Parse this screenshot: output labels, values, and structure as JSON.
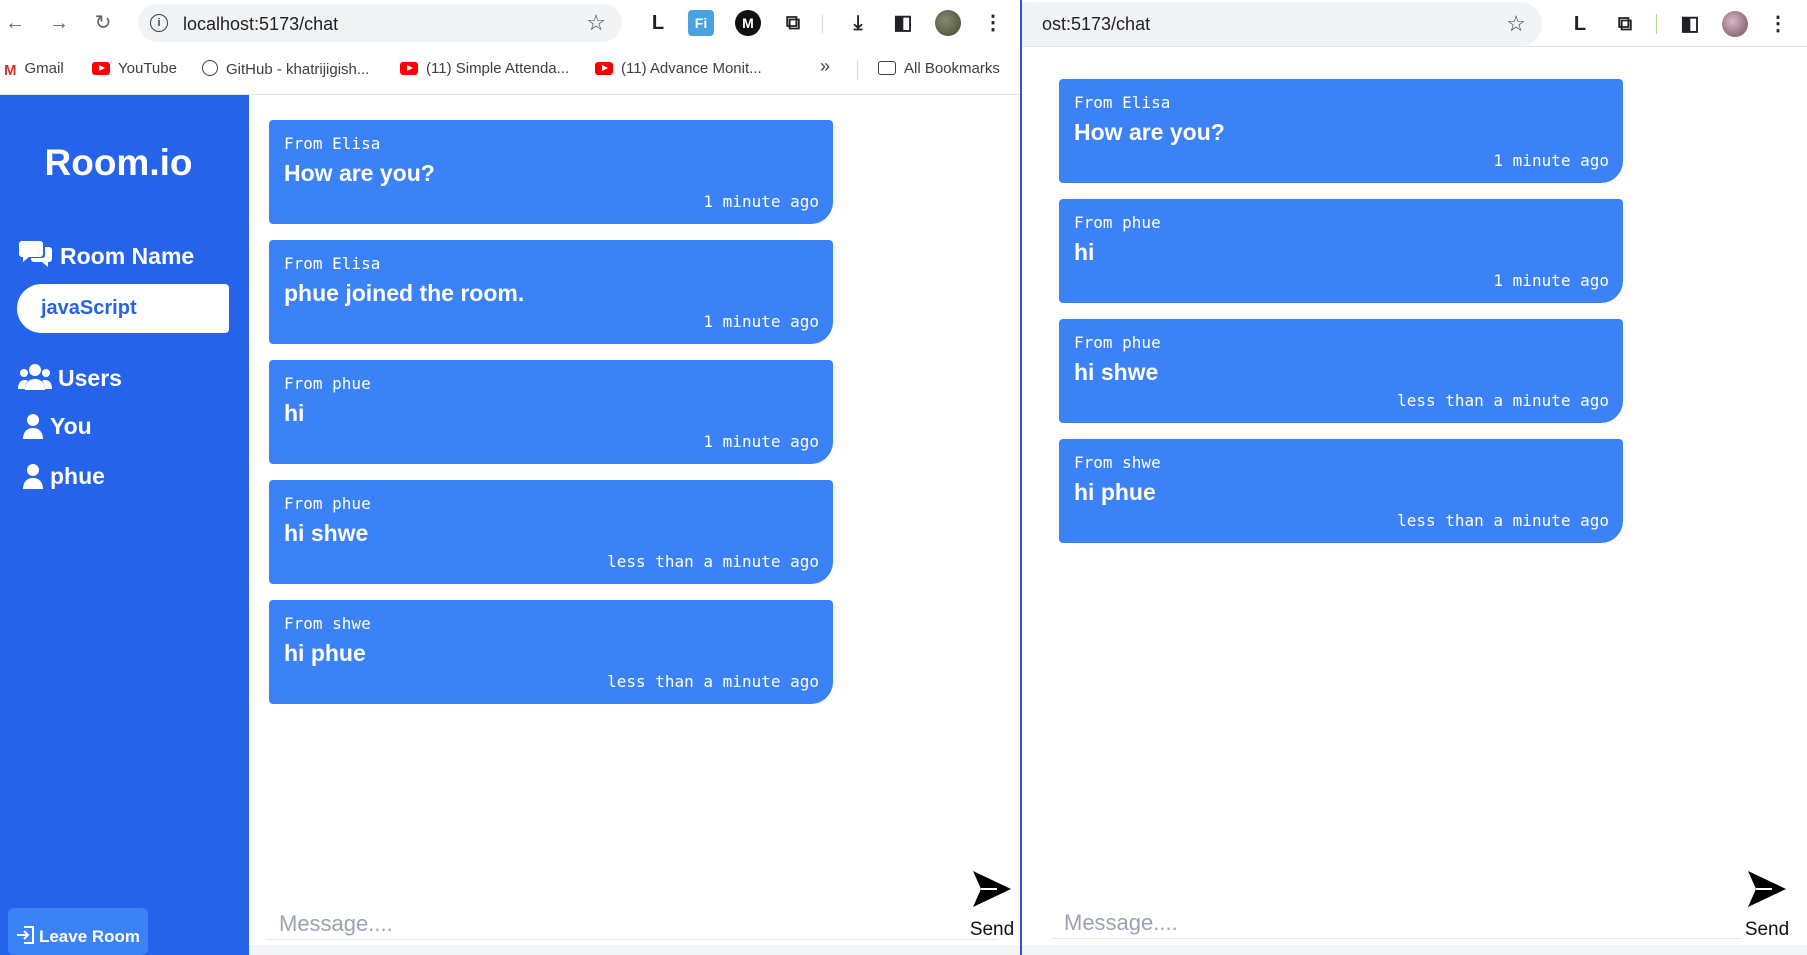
{
  "left_window": {
    "url": "localhost:5173/chat",
    "bookmarks": [
      "Gmail",
      "YouTube",
      "GitHub - khatrijigish...",
      "(11) Simple Attenda...",
      "(11) Advance Monit...",
      "All Bookmarks"
    ],
    "bookmarks_more": "»",
    "extensions": {
      "l": "L",
      "fi": "Fi",
      "m": "M"
    },
    "sidebar": {
      "brand": "Room.io",
      "room_heading": "Room Name",
      "room_name": "javaScript",
      "users_heading": "Users",
      "users": [
        "You",
        "phue"
      ],
      "leave_label": "Leave Room"
    },
    "messages": [
      {
        "from": "From Elisa",
        "text": "How are you?",
        "time": "1 minute ago"
      },
      {
        "from": "From Elisa",
        "text": "phue joined the room.",
        "time": "1 minute ago"
      },
      {
        "from": "From phue",
        "text": "hi",
        "time": "1 minute ago"
      },
      {
        "from": "From phue",
        "text": "hi shwe",
        "time": "less than a minute ago"
      },
      {
        "from": "From shwe",
        "text": "hi phue",
        "time": "less than a minute ago"
      }
    ],
    "composer": {
      "placeholder": "Message....",
      "send_label": "Send"
    }
  },
  "right_window": {
    "url": "ost:5173/chat",
    "extensions": {
      "l": "L"
    },
    "messages": [
      {
        "from": "From Elisa",
        "text": "How are you?",
        "time": "1 minute ago"
      },
      {
        "from": "From phue",
        "text": "hi",
        "time": "1 minute ago"
      },
      {
        "from": "From phue",
        "text": "hi shwe",
        "time": "less than a minute ago"
      },
      {
        "from": "From shwe",
        "text": "hi phue",
        "time": "less than a minute ago"
      }
    ],
    "composer": {
      "placeholder": "Message....",
      "send_label": "Send"
    }
  },
  "colors": {
    "sidebar": "#2563eb",
    "bubble": "#3b82f6",
    "leave_button": "#3b82f6"
  }
}
